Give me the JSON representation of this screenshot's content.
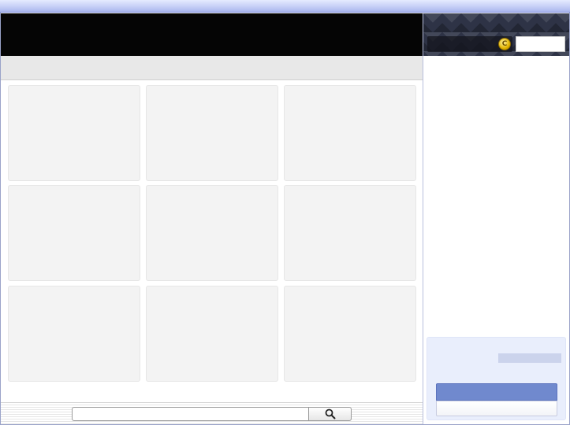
{
  "search": {
    "placeholder": "",
    "value": "",
    "button_icon": "magnifier-icon"
  },
  "account": {
    "currency_icon": "coin-icon",
    "currency_symbol": "C"
  },
  "colors": {
    "title_bar": "#c6cff6",
    "header": "#050505",
    "tile": "#f3f3f3",
    "promo_panel": "#e9eefc",
    "promo_button": "#7089ce"
  },
  "grid": {
    "rows": 3,
    "columns": 3
  }
}
